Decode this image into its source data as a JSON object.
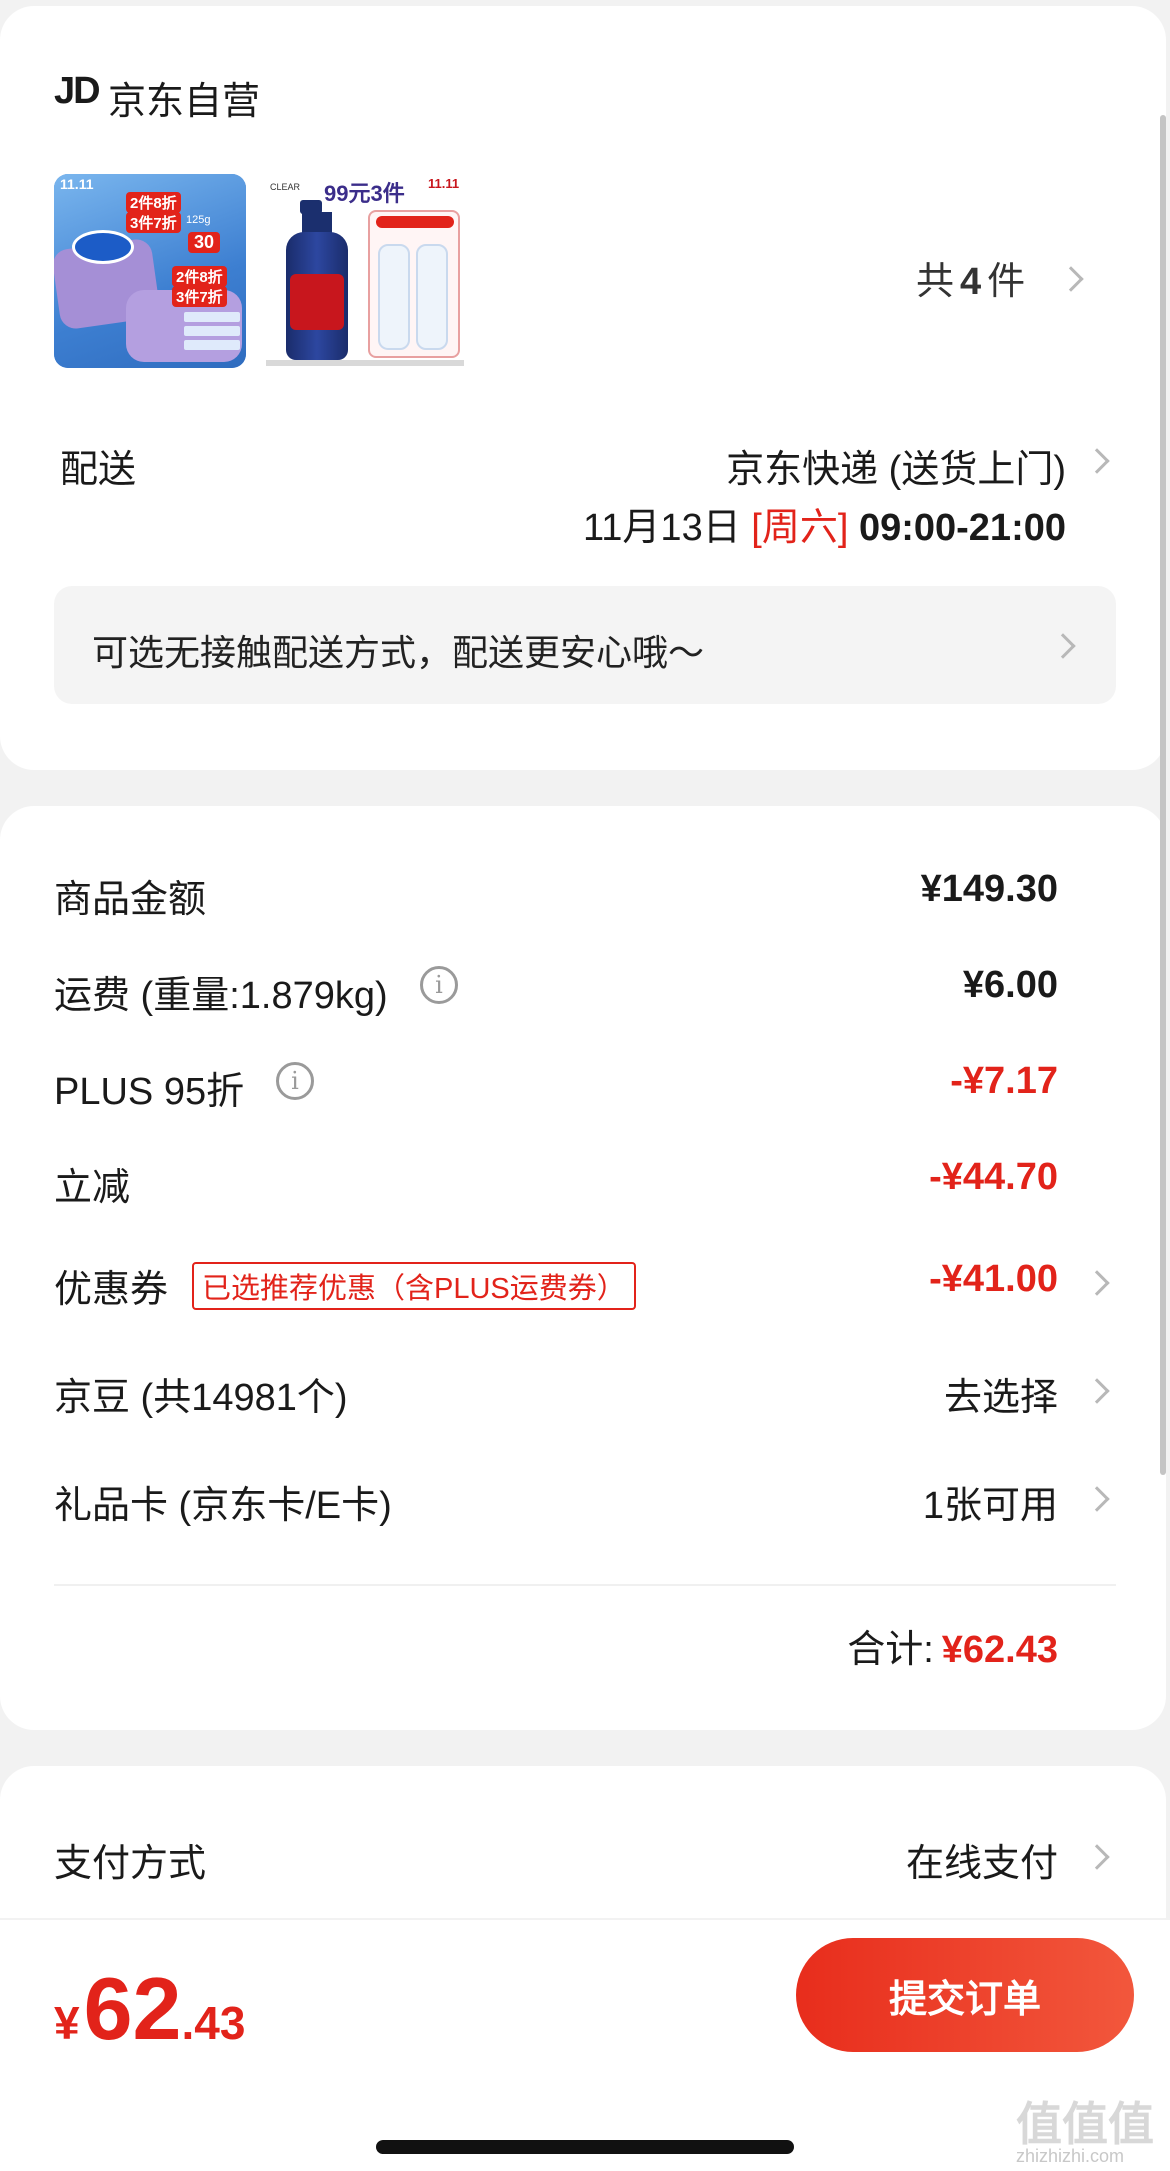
{
  "shop": {
    "logo": "JD",
    "name": "京东自营"
  },
  "products": {
    "count_prefix": "共",
    "count": "4",
    "count_suffix": "件",
    "item1": {
      "badge": "11.11",
      "promo_line1": "2件8折",
      "promo_line2": "3件7折",
      "price_badge": "30",
      "weight": "125g",
      "bottom_promo_line1": "2件8折",
      "bottom_promo_line2": "3件7折"
    },
    "item2": {
      "brand": "CLEAR",
      "promo": "99元3件",
      "badge": "11.11"
    }
  },
  "delivery": {
    "label": "配送",
    "method": "京东快递 (送货上门)",
    "date": "11月13日",
    "weekday": "[周六]",
    "time": "09:00-21:00",
    "contactless": "可选无接触配送方式，配送更安心哦～"
  },
  "pricing": {
    "goods_label": "商品金额",
    "goods_value": "¥149.30",
    "freight_label": "运费 (重量:1.879kg)",
    "freight_value": "¥6.00",
    "plus_label": "PLUS 95折",
    "plus_value": "-¥7.17",
    "instant_label": "立减",
    "instant_value": "-¥44.70",
    "coupon_label": "优惠券",
    "coupon_tag": "已选推荐优惠（含PLUS运费券）",
    "coupon_value": "-¥41.00",
    "beans_label": "京豆 (共14981个)",
    "beans_value": "去选择",
    "giftcard_label": "礼品卡 (京东卡/E卡)",
    "giftcard_value": "1张可用",
    "total_label": "合计:",
    "total_value": "¥62.43"
  },
  "payment": {
    "label": "支付方式",
    "value": "在线支付"
  },
  "footer": {
    "currency": "¥",
    "amount_int": "62",
    "amount_dec": ".43",
    "submit": "提交订单"
  },
  "watermark": {
    "glyphs": "值值值",
    "url": "zhizhizhi.com"
  },
  "colors": {
    "accent_red": "#e2231a",
    "button_start": "#e82d1c",
    "button_end": "#f2573c"
  }
}
